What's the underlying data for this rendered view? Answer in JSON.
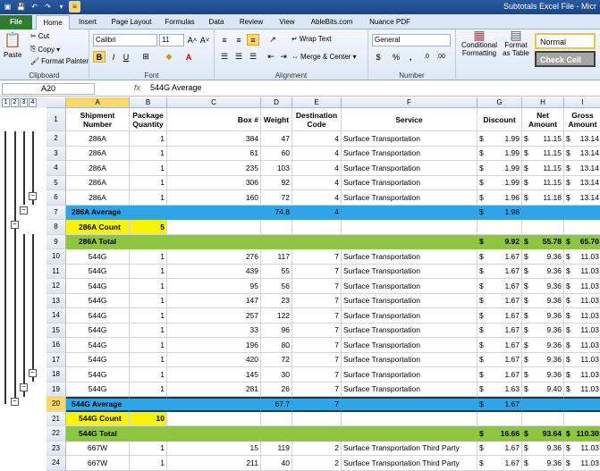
{
  "window": {
    "title": "Subtotals Excel File - Micr"
  },
  "tabs": [
    "File",
    "Home",
    "Insert",
    "Page Layout",
    "Formulas",
    "Data",
    "Review",
    "View",
    "AbleBits.com",
    "Nuance PDF"
  ],
  "ribbon": {
    "clipboard": {
      "paste": "Paste",
      "cut": "Cut",
      "copy": "Copy",
      "format_painter": "Format Painter",
      "label": "Clipboard"
    },
    "font": {
      "name": "Calibri",
      "size": "11",
      "label": "Font"
    },
    "alignment": {
      "wrap": "Wrap Text",
      "merge": "Merge & Center",
      "label": "Alignment"
    },
    "number": {
      "format": "General",
      "label": "Number"
    },
    "styles": {
      "conditional": "Conditional Formatting",
      "format_table": "Format as Table",
      "normal": "Normal",
      "check_cell": "Check Cell"
    }
  },
  "formula_bar": {
    "name_box": "A20",
    "fx": "fx",
    "content": "544G Average"
  },
  "outline_levels": [
    "1",
    "2",
    "3",
    "4"
  ],
  "columns": [
    "A",
    "B",
    "C",
    "D",
    "E",
    "F",
    "G",
    "H",
    "I"
  ],
  "header_row": {
    "num": "1",
    "cells": [
      "Shipment Number",
      "Package Quantity",
      "Box #",
      "Weight",
      "Destination Code",
      "Service",
      "Discount",
      "Net Amount",
      "Gross Amount"
    ]
  },
  "rows": [
    {
      "num": "2",
      "type": "data",
      "cells": [
        "286A",
        "1",
        "384",
        "47",
        "4",
        "Surface Transportation",
        "1.99",
        "11.15",
        "13.14"
      ]
    },
    {
      "num": "3",
      "type": "data",
      "cells": [
        "286A",
        "1",
        "61",
        "60",
        "4",
        "Surface Transportation",
        "1.99",
        "11.15",
        "13.14"
      ]
    },
    {
      "num": "4",
      "type": "data",
      "cells": [
        "286A",
        "1",
        "235",
        "103",
        "4",
        "Surface Transportation",
        "1.99",
        "11.15",
        "13.14"
      ]
    },
    {
      "num": "5",
      "type": "data",
      "cells": [
        "286A",
        "1",
        "306",
        "92",
        "4",
        "Surface Transportation",
        "1.99",
        "11.15",
        "13.14"
      ]
    },
    {
      "num": "6",
      "type": "data",
      "cells": [
        "286A",
        "1",
        "160",
        "72",
        "4",
        "Surface Transportation",
        "1.96",
        "11.18",
        "13.14"
      ]
    },
    {
      "num": "7",
      "type": "avg",
      "cells": [
        "286A Average",
        "",
        "",
        "74.8",
        "4",
        "",
        "1.98",
        "",
        ""
      ]
    },
    {
      "num": "8",
      "type": "cnt",
      "cells": [
        "286A Count",
        "5",
        "",
        "",
        "",
        "",
        "",
        "",
        ""
      ]
    },
    {
      "num": "9",
      "type": "tot",
      "cells": [
        "286A Total",
        "",
        "",
        "",
        "",
        "",
        "9.92",
        "55.78",
        "65.70"
      ]
    },
    {
      "num": "10",
      "type": "data",
      "cells": [
        "544G",
        "1",
        "276",
        "117",
        "7",
        "Surface Transportation",
        "1.67",
        "9.36",
        "11.03"
      ]
    },
    {
      "num": "11",
      "type": "data",
      "cells": [
        "544G",
        "1",
        "439",
        "55",
        "7",
        "Surface Transportation",
        "1.67",
        "9.36",
        "11.03"
      ]
    },
    {
      "num": "12",
      "type": "data",
      "cells": [
        "544G",
        "1",
        "95",
        "56",
        "7",
        "Surface Transportation",
        "1.67",
        "9.36",
        "11.03"
      ]
    },
    {
      "num": "13",
      "type": "data",
      "cells": [
        "544G",
        "1",
        "147",
        "23",
        "7",
        "Surface Transportation",
        "1.67",
        "9.36",
        "11.03"
      ]
    },
    {
      "num": "14",
      "type": "data",
      "cells": [
        "544G",
        "1",
        "257",
        "122",
        "7",
        "Surface Transportation",
        "1.67",
        "9.36",
        "11.03"
      ]
    },
    {
      "num": "15",
      "type": "data",
      "cells": [
        "544G",
        "1",
        "33",
        "96",
        "7",
        "Surface Transportation",
        "1.67",
        "9.36",
        "11.03"
      ]
    },
    {
      "num": "16",
      "type": "data",
      "cells": [
        "544G",
        "1",
        "196",
        "80",
        "7",
        "Surface Transportation",
        "1.67",
        "9.36",
        "11.03"
      ]
    },
    {
      "num": "17",
      "type": "data",
      "cells": [
        "544G",
        "1",
        "420",
        "72",
        "7",
        "Surface Transportation",
        "1.67",
        "9.36",
        "11.03"
      ]
    },
    {
      "num": "18",
      "type": "data",
      "cells": [
        "544G",
        "1",
        "145",
        "30",
        "7",
        "Surface Transportation",
        "1.67",
        "9.36",
        "11.03"
      ]
    },
    {
      "num": "19",
      "type": "data",
      "cells": [
        "544G",
        "1",
        "281",
        "26",
        "7",
        "Surface Transportation",
        "1.63",
        "9.40",
        "11.03"
      ]
    },
    {
      "num": "20",
      "type": "avg",
      "sel": true,
      "cells": [
        "544G Average",
        "",
        "",
        "67.7",
        "7",
        "",
        "1.67",
        "",
        ""
      ]
    },
    {
      "num": "21",
      "type": "cnt",
      "cells": [
        "544G Count",
        "10",
        "",
        "",
        "",
        "",
        "",
        "",
        ""
      ]
    },
    {
      "num": "22",
      "type": "tot",
      "cells": [
        "544G Total",
        "",
        "",
        "",
        "",
        "",
        "16.66",
        "93.64",
        "110.30"
      ]
    },
    {
      "num": "23",
      "type": "data",
      "cells": [
        "667W",
        "1",
        "15",
        "119",
        "2",
        "Surface Transportation Third Party",
        "1.67",
        "9.36",
        "11.03"
      ]
    },
    {
      "num": "24",
      "type": "data",
      "cells": [
        "667W",
        "1",
        "211",
        "40",
        "2",
        "Surface Transportation Third Party",
        "1.67",
        "9.36",
        "11.03"
      ]
    }
  ],
  "currency_symbol": "$",
  "colors": {
    "average_row": "#2ea5e6",
    "count_cell": "#f7f500",
    "total_row": "#8dc63f",
    "file_tab": "#2e7d2e"
  }
}
